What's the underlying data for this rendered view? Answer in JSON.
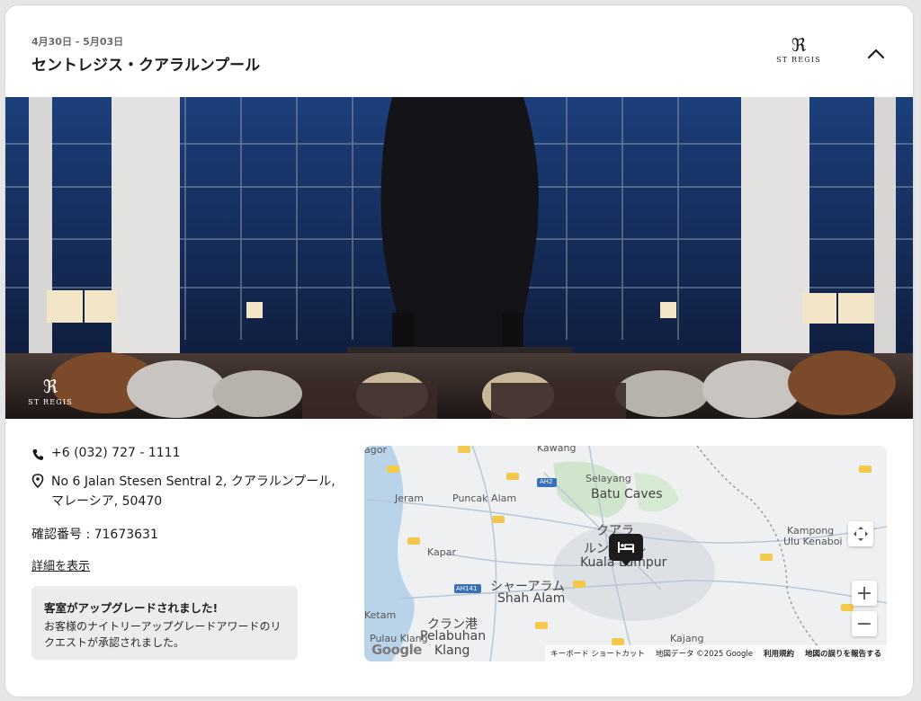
{
  "header": {
    "dates": "4月30日 - 5月03日",
    "hotel_name": "セントレジス・クアラルンプール",
    "logo_monogram": "ℜ",
    "logo_word": "ST REGIS",
    "collapse_icon": "chevron-up-icon"
  },
  "hero": {
    "logo_monogram": "ℜ",
    "logo_word": "ST REGIS"
  },
  "contact": {
    "phone": "+6 (032) 727 - 1111",
    "address": "No 6 Jalan Stesen Sentral 2, クアラルンプール, マレーシア, 50470",
    "confirmation": "確認番号 : 71673631",
    "details_link": "詳細を表示"
  },
  "notice": {
    "title": "客室がアップグレードされました!",
    "body": "お客様のナイトリーアップグレードアワードのリクエストが承認されました。"
  },
  "map": {
    "labels": {
      "kawang": "Kawang",
      "selayang": "Selayang",
      "batu_caves": "Batu Caves",
      "jeram": "Jeram",
      "puncak_alam": "Puncak Alam",
      "kapar": "Kapar",
      "kuala_lumpur_jp": "クアラ",
      "kuala_lumpur_jp2": "ルンプール",
      "kuala_lumpur": "Kuala Lumpur",
      "shah_alam_jp": "シャーアラム",
      "shah_alam": "Shah Alam",
      "klang_jp": "クラン港",
      "pelabuhan": "Pelabuhan",
      "klang": "Klang",
      "ketam": "Ketam",
      "pulau_klang": "Pulau Klang",
      "kajang": "Kajang",
      "kampong": "Kampong",
      "ulu_kenaboi": "Ulu Kenaboi",
      "ah2": "AH2",
      "ah141": "AH141",
      "agor": "agor"
    },
    "zoom_in": "+",
    "zoom_out": "−",
    "footer": {
      "keyboard": "キーボード ショートカット",
      "data": "地図データ ©2025 Google",
      "terms": "利用規約",
      "report": "地図の誤りを報告する"
    },
    "google": "Google"
  },
  "colors": {
    "accent": "#1c1c1c",
    "notice_bg": "#ececec"
  }
}
